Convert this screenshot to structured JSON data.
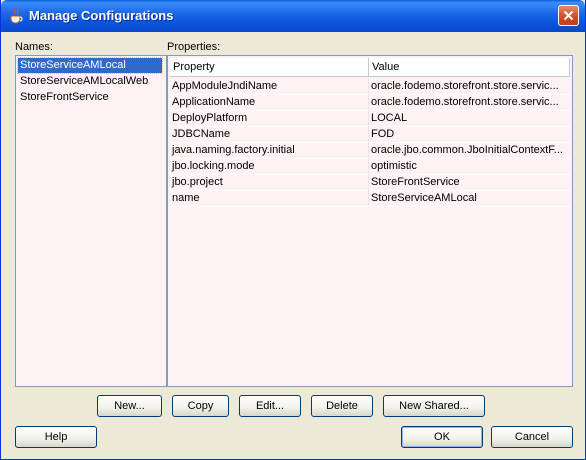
{
  "window": {
    "title": "Manage Configurations"
  },
  "names": {
    "label": "Names:",
    "items": [
      "StoreServiceAMLocal",
      "StoreServiceAMLocalWeb",
      "StoreFrontService"
    ],
    "selected": "StoreServiceAMLocal"
  },
  "properties": {
    "label": "Properties:",
    "columns": [
      "Property",
      "Value"
    ],
    "rows": [
      [
        "AppModuleJndiName",
        "oracle.fodemo.storefront.store.servic..."
      ],
      [
        "ApplicationName",
        "oracle.fodemo.storefront.store.servic..."
      ],
      [
        "DeployPlatform",
        "LOCAL"
      ],
      [
        "JDBCName",
        "FOD"
      ],
      [
        "java.naming.factory.initial",
        "oracle.jbo.common.JboInitialContextF..."
      ],
      [
        "jbo.locking.mode",
        "optimistic"
      ],
      [
        "jbo.project",
        "StoreFrontService"
      ],
      [
        "name",
        "StoreServiceAMLocal"
      ]
    ]
  },
  "buttons": {
    "new": "New...",
    "copy": "Copy",
    "edit": "Edit...",
    "delete": "Delete",
    "new_shared": "New Shared...",
    "help": "Help",
    "ok": "OK",
    "cancel": "Cancel"
  },
  "icons": {
    "title_icon": "java-cup-icon",
    "close": "close-icon"
  }
}
